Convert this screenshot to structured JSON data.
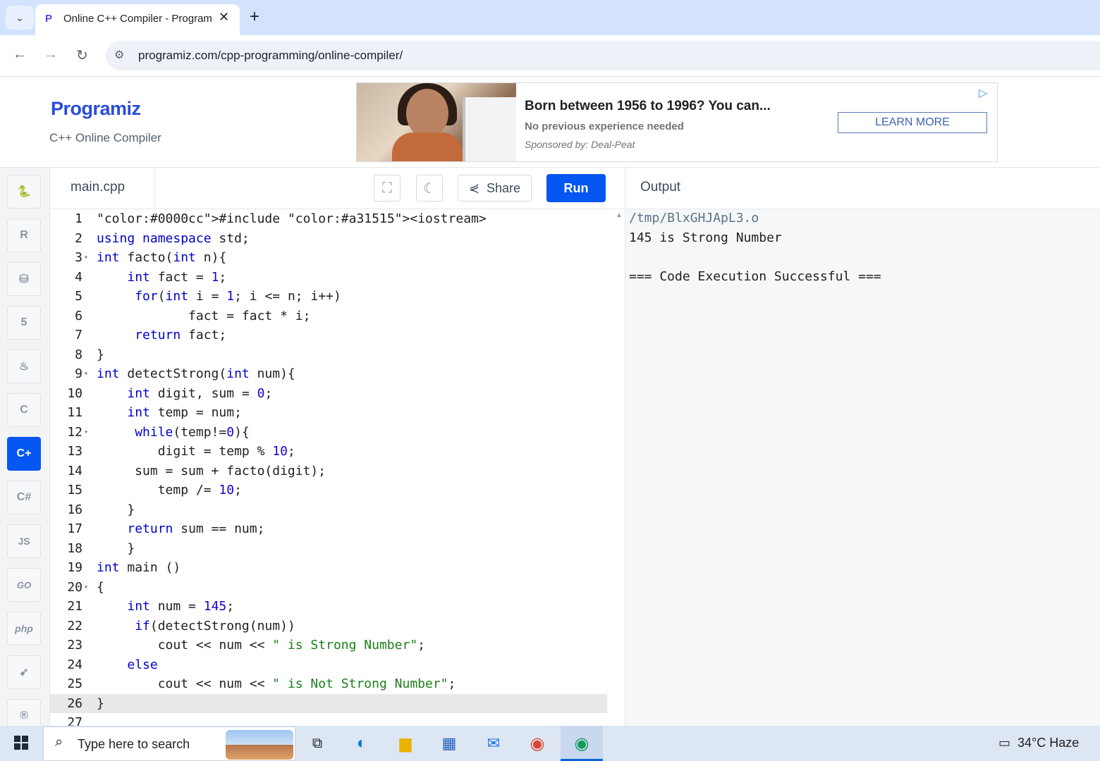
{
  "browser": {
    "tab_title": "Online C++ Compiler - Program",
    "url": "programiz.com/cpp-programming/online-compiler/"
  },
  "header": {
    "logo": "Programiz",
    "subtitle": "C++ Online Compiler"
  },
  "ad": {
    "title": "Born between 1956 to 1996? You can...",
    "subtitle": "No previous experience needed",
    "sponsor": "Sponsored by: Deal-Peat",
    "button": "LEARN MORE"
  },
  "sidebar": {
    "languages": [
      {
        "name": "python",
        "glyph": "🐍"
      },
      {
        "name": "r",
        "glyph": "R"
      },
      {
        "name": "sql",
        "glyph": "⛁"
      },
      {
        "name": "html",
        "glyph": "5"
      },
      {
        "name": "java",
        "glyph": "♨"
      },
      {
        "name": "c",
        "glyph": "C"
      },
      {
        "name": "cpp",
        "glyph": "C+"
      },
      {
        "name": "csharp",
        "glyph": "C#"
      },
      {
        "name": "js",
        "glyph": "JS"
      },
      {
        "name": "go",
        "glyph": "GO"
      },
      {
        "name": "php",
        "glyph": "php"
      },
      {
        "name": "swift",
        "glyph": "➶"
      },
      {
        "name": "rust",
        "glyph": "®"
      }
    ],
    "active": "cpp"
  },
  "editor": {
    "filename": "main.cpp",
    "share_label": "Share",
    "run_label": "Run",
    "active_line": 26,
    "lines": [
      {
        "n": "1",
        "fold": false,
        "code": "#include <iostream>"
      },
      {
        "n": "2",
        "fold": false,
        "code": "using namespace std;"
      },
      {
        "n": "3",
        "fold": true,
        "code": "int facto(int n){"
      },
      {
        "n": "4",
        "fold": false,
        "code": "    int fact = 1;"
      },
      {
        "n": "5",
        "fold": false,
        "code": "     for(int i = 1; i <= n; i++)"
      },
      {
        "n": "6",
        "fold": false,
        "code": "            fact = fact * i;"
      },
      {
        "n": "7",
        "fold": false,
        "code": "     return fact;"
      },
      {
        "n": "8",
        "fold": false,
        "code": "}"
      },
      {
        "n": "9",
        "fold": true,
        "code": "int detectStrong(int num){"
      },
      {
        "n": "10",
        "fold": false,
        "code": "    int digit, sum = 0;"
      },
      {
        "n": "11",
        "fold": false,
        "code": "    int temp = num;"
      },
      {
        "n": "12",
        "fold": true,
        "code": "     while(temp!=0){"
      },
      {
        "n": "13",
        "fold": false,
        "code": "        digit = temp % 10;"
      },
      {
        "n": "14",
        "fold": false,
        "code": "     sum = sum + facto(digit);"
      },
      {
        "n": "15",
        "fold": false,
        "code": "        temp /= 10;"
      },
      {
        "n": "16",
        "fold": false,
        "code": "    }"
      },
      {
        "n": "17",
        "fold": false,
        "code": "    return sum == num;"
      },
      {
        "n": "18",
        "fold": false,
        "code": "    }"
      },
      {
        "n": "19",
        "fold": false,
        "code": "int main ()"
      },
      {
        "n": "20",
        "fold": true,
        "code": "{"
      },
      {
        "n": "21",
        "fold": false,
        "code": "    int num = 145;"
      },
      {
        "n": "22",
        "fold": false,
        "code": "     if(detectStrong(num))"
      },
      {
        "n": "23",
        "fold": false,
        "code": "        cout << num << \" is Strong Number\";"
      },
      {
        "n": "24",
        "fold": false,
        "code": "    else"
      },
      {
        "n": "25",
        "fold": false,
        "code": "        cout << num << \" is Not Strong Number\";"
      },
      {
        "n": "26",
        "fold": false,
        "code": "}"
      },
      {
        "n": "27",
        "fold": false,
        "code": ""
      }
    ]
  },
  "output": {
    "heading": "Output",
    "lines": [
      "/tmp/BlxGHJApL3.o",
      "145 is Strong Number",
      "",
      "=== Code Execution Successful ==="
    ]
  },
  "taskbar": {
    "search_placeholder": "Type here to search",
    "weather": "34°C  Haze"
  }
}
